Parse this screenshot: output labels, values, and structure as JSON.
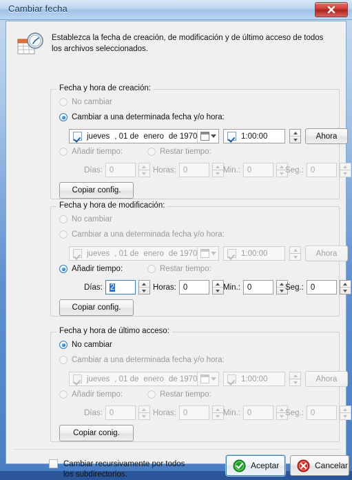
{
  "window": {
    "title": "Cambiar fecha",
    "close_label": "x",
    "header_text": "Establezca la fecha de creación, de modificación y de último acceso de todos los archivos seleccionados."
  },
  "common": {
    "no_change_label": "No cambiar",
    "change_to_label": "Cambiar a una determinada fecha y/o hora:",
    "add_time_label": "Añadir tiempo:",
    "subtract_time_label": "Restar tiempo:",
    "now_label": "Ahora",
    "days_label": "Días:",
    "hours_label": "Horas:",
    "minutes_label": "Min.:",
    "seconds_label": "Seg.:",
    "weekday": "jueves",
    "day": ", 01 de",
    "month": "enero",
    "year": "de 1970",
    "time": "1:00:00"
  },
  "groups": [
    {
      "legend": "Fecha y hora de creación:",
      "selected_mode": "change_to",
      "date_enabled": true,
      "date_checked": true,
      "time_checked": true,
      "copy_label": "Copiar config.",
      "time_fields_enabled": false,
      "days": "0",
      "hours": "0",
      "minutes": "0",
      "seconds": "0"
    },
    {
      "legend": "Fecha y hora de modificación:",
      "selected_mode": "add_time",
      "date_enabled": false,
      "date_checked": true,
      "time_checked": true,
      "copy_label": "Copiar config.",
      "time_fields_enabled": true,
      "days": "2",
      "hours": "0",
      "minutes": "0",
      "seconds": "0"
    },
    {
      "legend": "Fecha y hora de último acceso:",
      "selected_mode": "no_change",
      "date_enabled": false,
      "date_checked": true,
      "time_checked": true,
      "copy_label": "Copiar conig.",
      "time_fields_enabled": false,
      "days": "0",
      "hours": "0",
      "minutes": "0",
      "seconds": "0"
    }
  ],
  "footer": {
    "recursive_label": "Cambiar recursivamente por todos los subdirectorios.",
    "recursive_checked": false,
    "accept_label": "Aceptar",
    "cancel_label": "Cancelar"
  },
  "colors": {
    "accent_blue": "#3c7fb1",
    "ok_green": "#1f9e27",
    "cancel_red": "#cc2b24",
    "close_red": "#cf3f3c",
    "selection_blue": "#2f6fc4"
  }
}
